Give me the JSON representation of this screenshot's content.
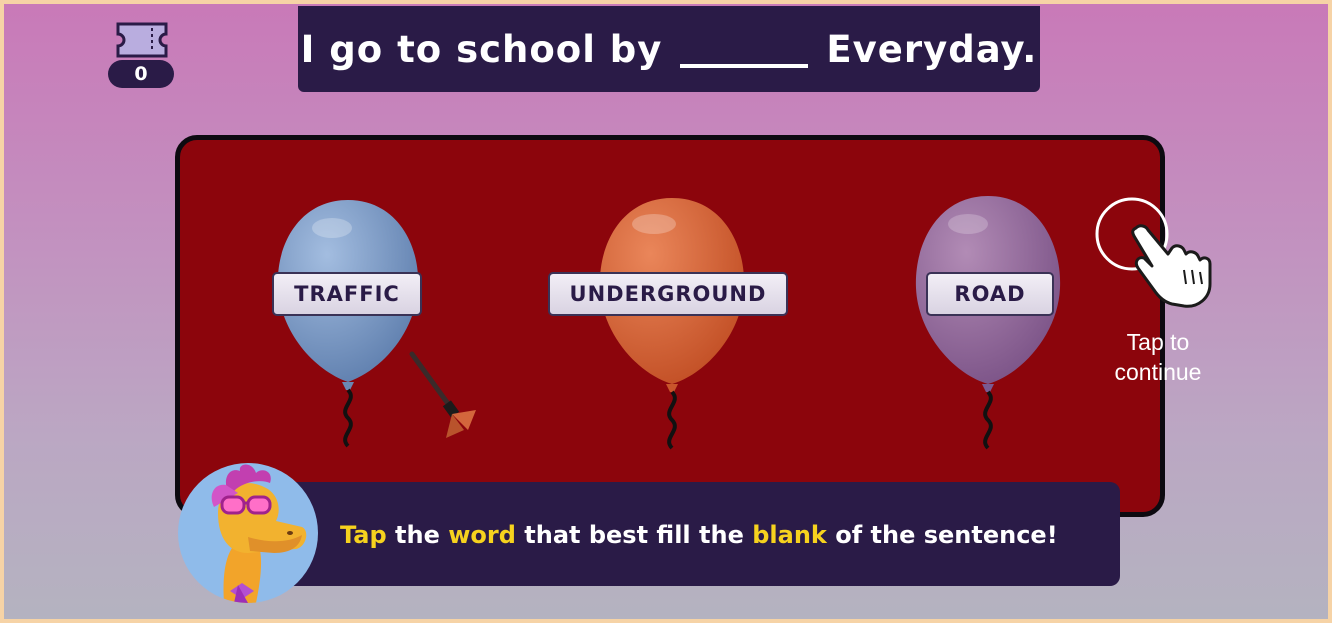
{
  "tickets": {
    "icon": "ticket-icon",
    "count": "0"
  },
  "sentence": {
    "before": "I go to school by",
    "after": "Everyday."
  },
  "choices": [
    {
      "label": "TRAFFIC",
      "color": "#7e9fcb"
    },
    {
      "label": "UNDERGROUND",
      "color": "#d3663c"
    },
    {
      "label": "ROAD",
      "color": "#9874a8"
    }
  ],
  "hint": {
    "icon": "pointing-hand-icon",
    "text_line1": "Tap to",
    "text_line2": "continue"
  },
  "instruction": {
    "w1": "Tap",
    "w2": "the",
    "w3": "word",
    "w4": "that best fill the",
    "w5": "blank",
    "w6": "of the sentence!"
  },
  "colors": {
    "board": "#8c050c",
    "panel": "#2a1b47",
    "highlight": "#f6d21e"
  }
}
